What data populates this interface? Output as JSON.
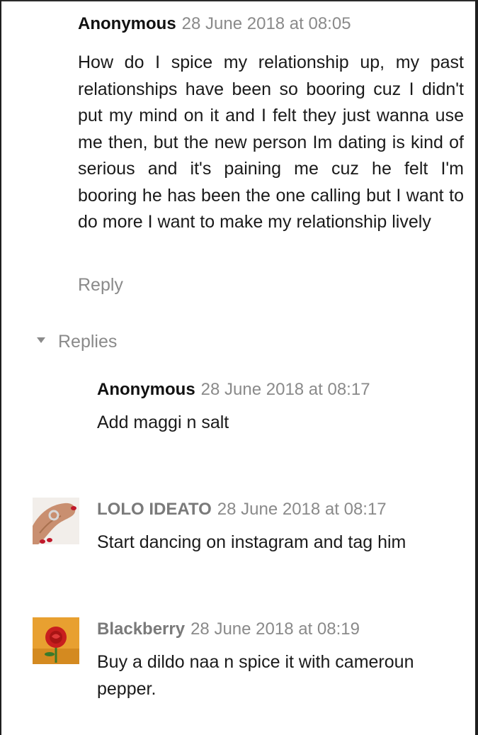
{
  "comment": {
    "author": "Anonymous",
    "date": "28 June 2018 at 08:05",
    "text": "How do I spice my relationship up, my past relationships have been so booring cuz I didn't put my mind on it and I felt they just wanna use me then, but the new person Im dating is kind of serious and it's paining me cuz he felt I'm booring he has been the one calling but I want to do more I want to make my relationship lively",
    "reply_label": "Reply"
  },
  "replies_toggle": {
    "label": "Replies",
    "icon": "triangle-down-icon"
  },
  "replies": [
    {
      "author": "Anonymous",
      "date": "28 June 2018 at 08:17",
      "text": "Add maggi n salt",
      "avatar": null
    },
    {
      "author": "LOLO IDEATO",
      "date": "28 June 2018 at 08:17",
      "text": "Start dancing on instagram and tag him",
      "avatar": "hand-ring-avatar"
    },
    {
      "author": "Blackberry",
      "date": "28 June 2018 at 08:19",
      "text": "Buy a dildo naa n spice it with cameroun pepper.",
      "avatar": "red-rose-avatar"
    }
  ],
  "colors": {
    "text": "#1a1a1a",
    "muted": "#8a8a8a",
    "link_author": "#7a7a7a",
    "background": "#ffffff"
  }
}
